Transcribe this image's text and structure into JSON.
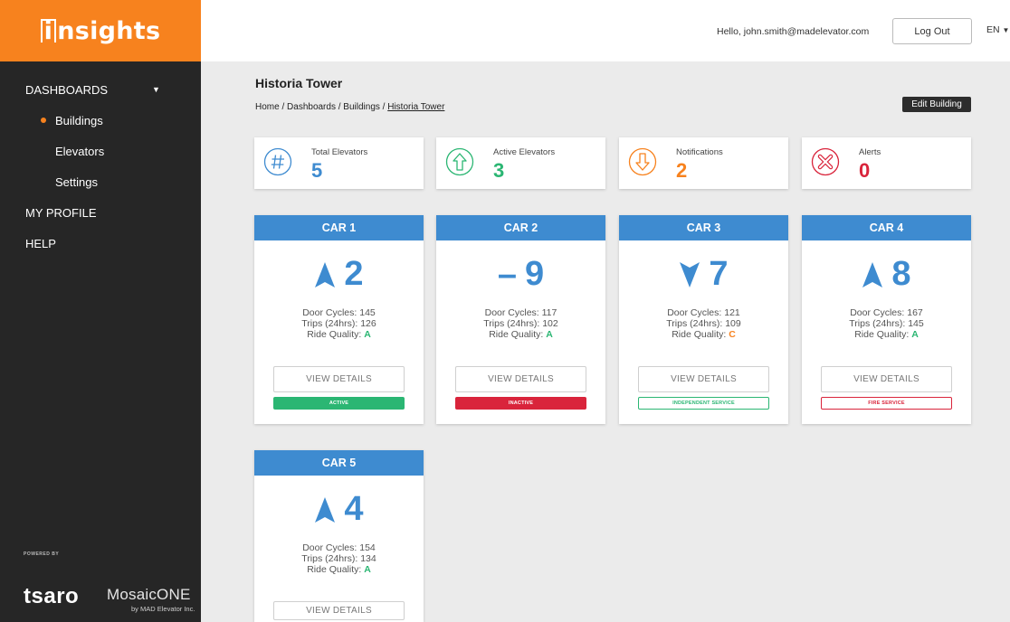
{
  "app": {
    "logo_prefix": "i",
    "logo_text": "nsights"
  },
  "sidebar": {
    "items": [
      {
        "label": "DASHBOARDS"
      },
      {
        "label": "Buildings"
      },
      {
        "label": "Elevators"
      },
      {
        "label": "Settings"
      },
      {
        "label": "MY PROFILE"
      },
      {
        "label": "HELP"
      }
    ],
    "powered_by": "POWERED BY",
    "brand": "tsaro",
    "partner": "MosaicONE",
    "partner_sub": "by MAD Elevator Inc."
  },
  "header": {
    "greeting": "Hello, john.smith@madelevator.com",
    "logout_label": "Log Out",
    "language": "EN"
  },
  "page": {
    "title": "Historia Tower",
    "breadcrumb": [
      "Home",
      "Dashboards",
      "Buildings",
      "Historia Tower"
    ],
    "edit_label": "Edit Building"
  },
  "stats": [
    {
      "label": "Total Elevators",
      "value": "5",
      "color": "#3e8bd0",
      "icon": "hash-icon"
    },
    {
      "label": "Active Elevators",
      "value": "3",
      "color": "#2bb673",
      "icon": "arrow-up-circle-icon"
    },
    {
      "label": "Notifications",
      "value": "2",
      "color": "#f7821e",
      "icon": "arrow-down-circle-icon"
    },
    {
      "label": "Alerts",
      "value": "0",
      "color": "#d9243b",
      "icon": "x-circle-icon"
    }
  ],
  "cars": [
    {
      "name": "CAR 1",
      "direction": "up",
      "floor": "2",
      "door_cycles": "Door Cycles: 145",
      "trips": "Trips (24hrs): 126",
      "rq_label": "Ride Quality: ",
      "rq": "A",
      "view_label": "VIEW DETAILS",
      "status": "ACTIVE",
      "status_type": "active"
    },
    {
      "name": "CAR 2",
      "direction": "idle",
      "floor": "9",
      "door_cycles": "Door Cycles: 117",
      "trips": "Trips (24hrs): 102",
      "rq_label": "Ride Quality: ",
      "rq": "A",
      "view_label": "VIEW DETAILS",
      "status": "INACTIVE",
      "status_type": "inactive"
    },
    {
      "name": "CAR 3",
      "direction": "down",
      "floor": "7",
      "door_cycles": "Door Cycles: 121",
      "trips": "Trips (24hrs): 109",
      "rq_label": "Ride Quality: ",
      "rq": "C",
      "view_label": "VIEW DETAILS",
      "status": "INDEPENDENT SERVICE",
      "status_type": "indep"
    },
    {
      "name": "CAR 4",
      "direction": "up",
      "floor": "8",
      "door_cycles": "Door Cycles: 167",
      "trips": "Trips (24hrs): 145",
      "rq_label": "Ride Quality: ",
      "rq": "A",
      "view_label": "VIEW DETAILS",
      "status": "FIRE SERVICE",
      "status_type": "fire"
    },
    {
      "name": "CAR 5",
      "direction": "up",
      "floor": "4",
      "door_cycles": "Door Cycles: 154",
      "trips": "Trips (24hrs): 134",
      "rq_label": "Ride Quality: ",
      "rq": "A",
      "view_label": "VIEW DETAILS",
      "status": "",
      "status_type": ""
    }
  ]
}
